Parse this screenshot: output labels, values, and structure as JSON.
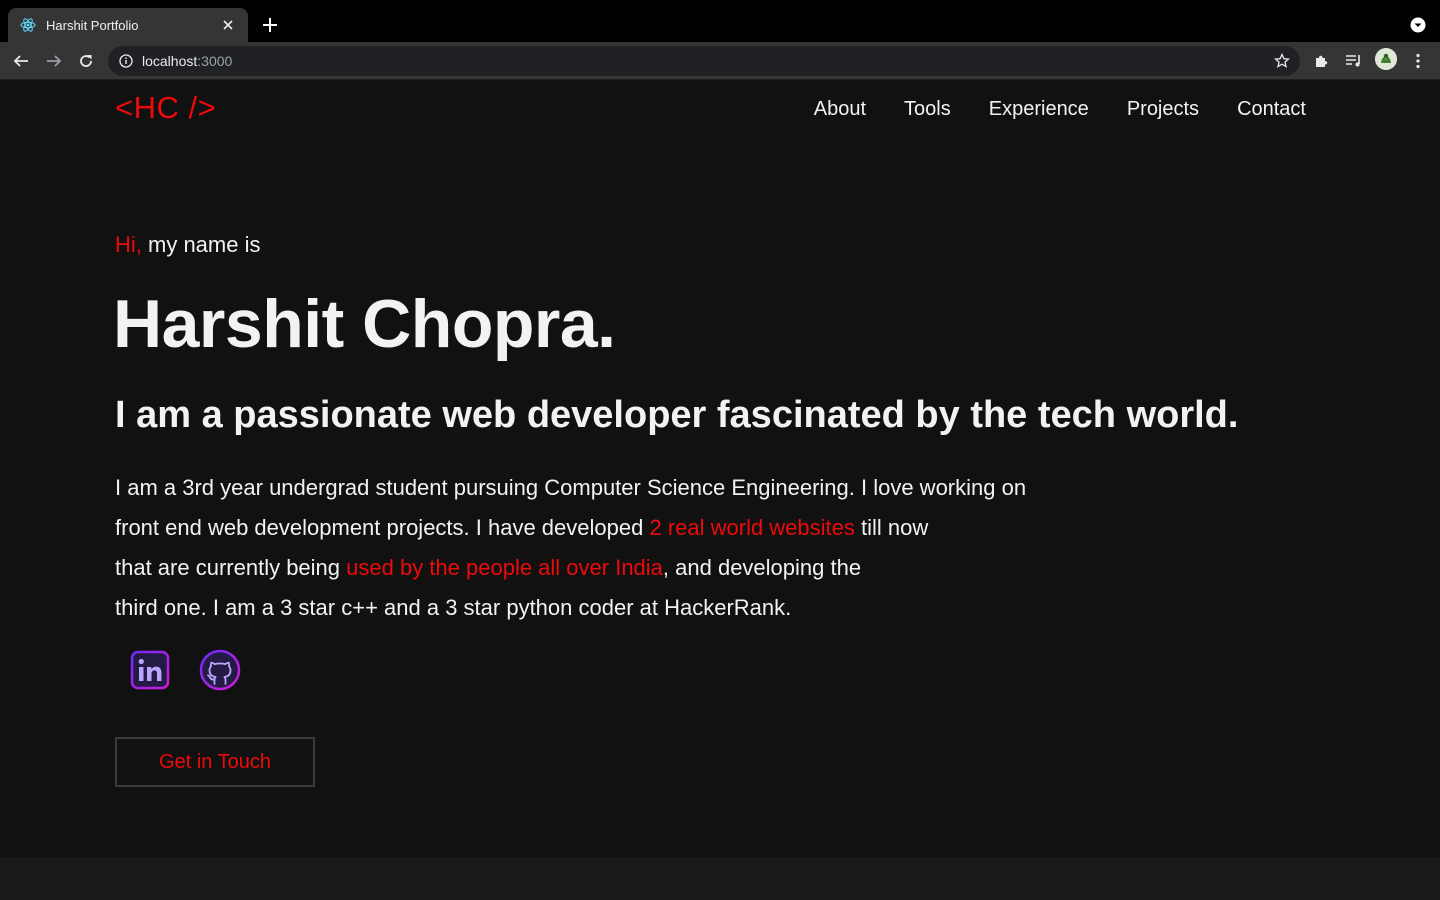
{
  "browser": {
    "tab_title": "Harshit Portfolio",
    "url_host": "localhost",
    "url_port": ":3000"
  },
  "site": {
    "logo": "<HC />",
    "nav": [
      "About",
      "Tools",
      "Experience",
      "Projects",
      "Contact"
    ]
  },
  "hero": {
    "greeting_hi": "Hi,",
    "greeting_rest": " my name is",
    "name": "Harshit Chopra.",
    "tagline": "I am a passionate web developer fascinated by the tech world.",
    "bio": {
      "line1": "I am a 3rd year undergrad student pursuing Computer Science Engineering. I love working on",
      "line2_pre": "front end web development projects. I have developed ",
      "line2_hl": "2 real world websites",
      "line2_post": " till now",
      "line3_pre": "that are currently being ",
      "line3_hl": "used by the people all over India",
      "line3_post": ", and developing the",
      "line4": "third one. I am a 3 star c++ and a 3 star python coder at HackerRank."
    },
    "cta_label": "Get in Touch"
  },
  "icons": {
    "favicon": "react-icon",
    "social": [
      "linkedin-icon",
      "github-icon"
    ]
  },
  "colors": {
    "accent": "#ee0a0a",
    "background": "#111111",
    "text": "#f2f2f2",
    "social_gradient": [
      "#6f2bff",
      "#d21bd6"
    ]
  }
}
